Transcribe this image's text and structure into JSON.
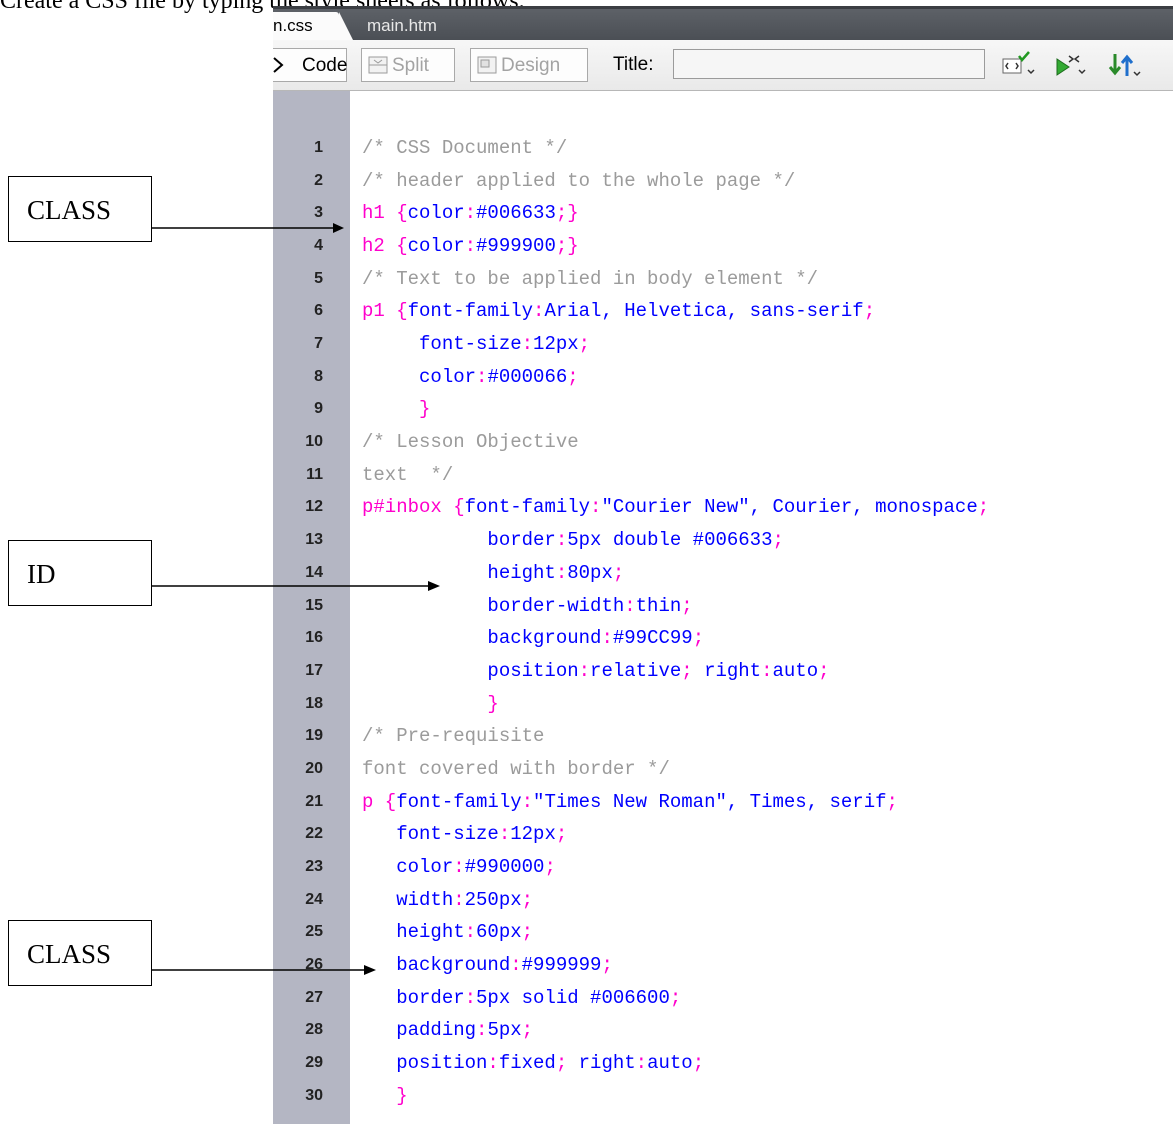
{
  "doc_text": "Create a CSS file by typing the style sheets as follows.",
  "tabs": [
    {
      "label": "n.css"
    },
    {
      "label": "main.htm"
    }
  ],
  "toolbar": {
    "code_label": "Code",
    "split_label": "Split",
    "design_label": "Design",
    "title_label": "Title:",
    "title_value": ""
  },
  "annotations": [
    {
      "label": "CLASS"
    },
    {
      "label": "ID"
    },
    {
      "label": "CLASS"
    }
  ],
  "colors": {
    "selector": "#ff00cc",
    "property": "#0000ff",
    "comment": "#9b9b9b",
    "gutter": "#b4b6c3",
    "tabbar": "#55595f"
  },
  "code_lines": [
    {
      "num": "1",
      "tokens": [
        {
          "t": "/* CSS Document */",
          "c": "comment"
        }
      ]
    },
    {
      "num": "2",
      "tokens": [
        {
          "t": "/* header applied to the whole page */",
          "c": "comment"
        }
      ]
    },
    {
      "num": "3",
      "tokens": [
        {
          "t": "h1 {",
          "c": "sel"
        },
        {
          "t": "color",
          "c": "prop"
        },
        {
          "t": ":",
          "c": "punc"
        },
        {
          "t": "#006633",
          "c": "prop"
        },
        {
          "t": ";}",
          "c": "punc"
        }
      ]
    },
    {
      "num": "4",
      "tokens": [
        {
          "t": "h2 {",
          "c": "sel"
        },
        {
          "t": "color",
          "c": "prop"
        },
        {
          "t": ":",
          "c": "punc"
        },
        {
          "t": "#999900",
          "c": "prop"
        },
        {
          "t": ";}",
          "c": "punc"
        }
      ]
    },
    {
      "num": "5",
      "tokens": [
        {
          "t": "/* Text to be applied in body element */",
          "c": "comment"
        }
      ]
    },
    {
      "num": "6",
      "tokens": [
        {
          "t": "p1 {",
          "c": "sel"
        },
        {
          "t": "font-family",
          "c": "prop"
        },
        {
          "t": ":",
          "c": "punc"
        },
        {
          "t": "Arial, Helvetica, sans-serif",
          "c": "prop"
        },
        {
          "t": ";",
          "c": "punc"
        }
      ]
    },
    {
      "num": "7",
      "tokens": [
        {
          "t": "     font-size",
          "c": "prop"
        },
        {
          "t": ":",
          "c": "punc"
        },
        {
          "t": "12px",
          "c": "prop"
        },
        {
          "t": ";",
          "c": "punc"
        }
      ]
    },
    {
      "num": "8",
      "tokens": [
        {
          "t": "     color",
          "c": "prop"
        },
        {
          "t": ":",
          "c": "punc"
        },
        {
          "t": "#000066",
          "c": "prop"
        },
        {
          "t": ";",
          "c": "punc"
        }
      ]
    },
    {
      "num": "9",
      "tokens": [
        {
          "t": "     }",
          "c": "punc"
        }
      ]
    },
    {
      "num": "10",
      "tokens": [
        {
          "t": "/* Lesson Objective",
          "c": "comment"
        }
      ]
    },
    {
      "num": "11",
      "tokens": [
        {
          "t": "text  */",
          "c": "comment"
        }
      ]
    },
    {
      "num": "12",
      "tokens": [
        {
          "t": "p#inbox {",
          "c": "sel"
        },
        {
          "t": "font-family",
          "c": "prop"
        },
        {
          "t": ":",
          "c": "punc"
        },
        {
          "t": "\"Courier New\", Courier, monospace",
          "c": "prop"
        },
        {
          "t": ";",
          "c": "punc"
        }
      ]
    },
    {
      "num": "13",
      "tokens": [
        {
          "t": "           border",
          "c": "prop"
        },
        {
          "t": ":",
          "c": "punc"
        },
        {
          "t": "5px double #006633",
          "c": "prop"
        },
        {
          "t": ";",
          "c": "punc"
        }
      ]
    },
    {
      "num": "14",
      "tokens": [
        {
          "t": "           height",
          "c": "prop"
        },
        {
          "t": ":",
          "c": "punc"
        },
        {
          "t": "80px",
          "c": "prop"
        },
        {
          "t": ";",
          "c": "punc"
        }
      ]
    },
    {
      "num": "15",
      "tokens": [
        {
          "t": "           border-width",
          "c": "prop"
        },
        {
          "t": ":",
          "c": "punc"
        },
        {
          "t": "thin",
          "c": "prop"
        },
        {
          "t": ";",
          "c": "punc"
        }
      ]
    },
    {
      "num": "16",
      "tokens": [
        {
          "t": "           background",
          "c": "prop"
        },
        {
          "t": ":",
          "c": "punc"
        },
        {
          "t": "#99CC99",
          "c": "prop"
        },
        {
          "t": ";",
          "c": "punc"
        }
      ]
    },
    {
      "num": "17",
      "tokens": [
        {
          "t": "           position",
          "c": "prop"
        },
        {
          "t": ":",
          "c": "punc"
        },
        {
          "t": "relative",
          "c": "prop"
        },
        {
          "t": "; ",
          "c": "punc"
        },
        {
          "t": "right",
          "c": "prop"
        },
        {
          "t": ":",
          "c": "punc"
        },
        {
          "t": "auto",
          "c": "prop"
        },
        {
          "t": ";",
          "c": "punc"
        }
      ]
    },
    {
      "num": "18",
      "tokens": [
        {
          "t": "           }",
          "c": "punc"
        }
      ]
    },
    {
      "num": "19",
      "tokens": [
        {
          "t": "/* Pre-requisite",
          "c": "comment"
        }
      ]
    },
    {
      "num": "20",
      "tokens": [
        {
          "t": "font covered with border */",
          "c": "comment"
        }
      ]
    },
    {
      "num": "21",
      "tokens": [
        {
          "t": "p {",
          "c": "sel"
        },
        {
          "t": "font-family",
          "c": "prop"
        },
        {
          "t": ":",
          "c": "punc"
        },
        {
          "t": "\"Times New Roman\", Times, serif",
          "c": "prop"
        },
        {
          "t": ";",
          "c": "punc"
        }
      ]
    },
    {
      "num": "22",
      "tokens": [
        {
          "t": "   font-size",
          "c": "prop"
        },
        {
          "t": ":",
          "c": "punc"
        },
        {
          "t": "12px",
          "c": "prop"
        },
        {
          "t": ";",
          "c": "punc"
        }
      ]
    },
    {
      "num": "23",
      "tokens": [
        {
          "t": "   color",
          "c": "prop"
        },
        {
          "t": ":",
          "c": "punc"
        },
        {
          "t": "#990000",
          "c": "prop"
        },
        {
          "t": ";",
          "c": "punc"
        }
      ]
    },
    {
      "num": "24",
      "tokens": [
        {
          "t": "   width",
          "c": "prop"
        },
        {
          "t": ":",
          "c": "punc"
        },
        {
          "t": "250px",
          "c": "prop"
        },
        {
          "t": ";",
          "c": "punc"
        }
      ]
    },
    {
      "num": "25",
      "tokens": [
        {
          "t": "   height",
          "c": "prop"
        },
        {
          "t": ":",
          "c": "punc"
        },
        {
          "t": "60px",
          "c": "prop"
        },
        {
          "t": ";",
          "c": "punc"
        }
      ]
    },
    {
      "num": "26",
      "tokens": [
        {
          "t": "   background",
          "c": "prop"
        },
        {
          "t": ":",
          "c": "punc"
        },
        {
          "t": "#999999",
          "c": "prop"
        },
        {
          "t": ";",
          "c": "punc"
        }
      ]
    },
    {
      "num": "27",
      "tokens": [
        {
          "t": "   border",
          "c": "prop"
        },
        {
          "t": ":",
          "c": "punc"
        },
        {
          "t": "5px solid #006600",
          "c": "prop"
        },
        {
          "t": ";",
          "c": "punc"
        }
      ]
    },
    {
      "num": "28",
      "tokens": [
        {
          "t": "   padding",
          "c": "prop"
        },
        {
          "t": ":",
          "c": "punc"
        },
        {
          "t": "5px",
          "c": "prop"
        },
        {
          "t": ";",
          "c": "punc"
        }
      ]
    },
    {
      "num": "29",
      "tokens": [
        {
          "t": "   position",
          "c": "prop"
        },
        {
          "t": ":",
          "c": "punc"
        },
        {
          "t": "fixed",
          "c": "prop"
        },
        {
          "t": "; ",
          "c": "punc"
        },
        {
          "t": "right",
          "c": "prop"
        },
        {
          "t": ":",
          "c": "punc"
        },
        {
          "t": "auto",
          "c": "prop"
        },
        {
          "t": ";",
          "c": "punc"
        }
      ]
    },
    {
      "num": "30",
      "tokens": [
        {
          "t": "   }",
          "c": "punc"
        }
      ]
    }
  ]
}
